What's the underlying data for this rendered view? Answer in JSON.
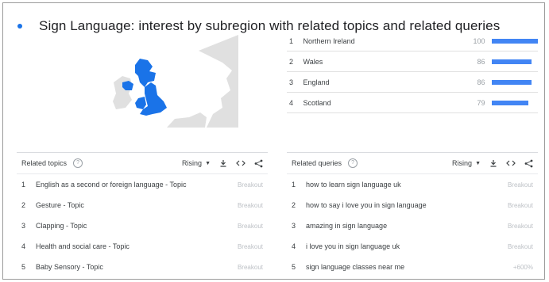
{
  "title": "Sign Language: interest by subregion with related topics and related queries",
  "colors": {
    "accent": "#4285f4",
    "map_land": "#e0e0e0",
    "map_highlight": "#1a73e8"
  },
  "subregions": [
    {
      "rank": "1",
      "name": "Northern Ireland",
      "value": "100",
      "fraction": 1.0
    },
    {
      "rank": "2",
      "name": "Wales",
      "value": "86",
      "fraction": 0.86
    },
    {
      "rank": "3",
      "name": "England",
      "value": "86",
      "fraction": 0.86
    },
    {
      "rank": "4",
      "name": "Scotland",
      "value": "79",
      "fraction": 0.79
    }
  ],
  "related_topics": {
    "title": "Related topics",
    "sort": "Rising",
    "rows": [
      {
        "rank": "1",
        "label": "English as a second or foreign language - Topic",
        "value": "Breakout"
      },
      {
        "rank": "2",
        "label": "Gesture - Topic",
        "value": "Breakout"
      },
      {
        "rank": "3",
        "label": "Clapping - Topic",
        "value": "Breakout"
      },
      {
        "rank": "4",
        "label": "Health and social care - Topic",
        "value": "Breakout"
      },
      {
        "rank": "5",
        "label": "Baby Sensory - Topic",
        "value": "Breakout"
      }
    ]
  },
  "related_queries": {
    "title": "Related queries",
    "sort": "Rising",
    "rows": [
      {
        "rank": "1",
        "label": "how to learn sign language uk",
        "value": "Breakout"
      },
      {
        "rank": "2",
        "label": "how to say i love you in sign language",
        "value": "Breakout"
      },
      {
        "rank": "3",
        "label": "amazing in sign language",
        "value": "Breakout"
      },
      {
        "rank": "4",
        "label": "i love you in sign language uk",
        "value": "Breakout"
      },
      {
        "rank": "5",
        "label": "sign language classes near me",
        "value": "+600%"
      }
    ]
  },
  "icons": [
    "help-icon",
    "caret-down-icon",
    "download-icon",
    "embed-icon",
    "share-icon"
  ]
}
